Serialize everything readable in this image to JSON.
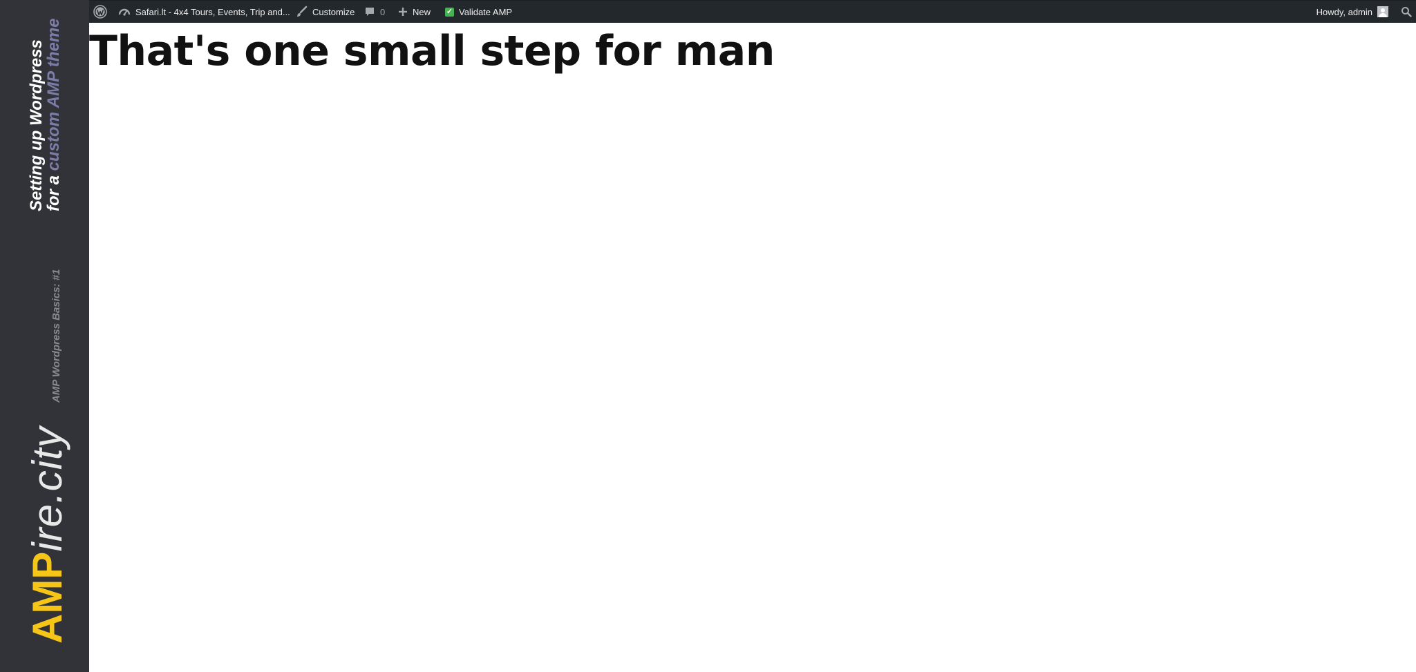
{
  "side_banner": {
    "series_title_line1": "Setting up Wordpress",
    "series_title_line2_plain": "for a ",
    "series_title_line2_accent": "custom AMP theme",
    "series_subtitle": "AMP Wordpress Basics: #1",
    "brand_bold": "AMP",
    "brand_rest": "ire.city",
    "colors": {
      "background": "#323338",
      "accent": "#7c7ca8",
      "brand_yellow": "#f5c518"
    }
  },
  "admin_bar": {
    "site_name": "Safari.lt - 4x4 Tours, Events, Trip and...",
    "customize_label": "Customize",
    "comments_count": "0",
    "new_label": "New",
    "validate_label": "Validate AMP",
    "howdy_label": "Howdy, admin",
    "icons": {
      "wp": "wordpress-logo-icon",
      "site": "dashboard-icon",
      "customize": "paintbrush-icon",
      "comments": "comment-icon",
      "new": "plus-icon",
      "validate": "checkbox-icon",
      "avatar": "user-avatar-icon",
      "search": "search-icon"
    },
    "colors": {
      "background": "#23282d",
      "text": "#eeeeee",
      "validate_green": "#46b450"
    }
  },
  "main": {
    "heading": "That's one small step for man"
  }
}
